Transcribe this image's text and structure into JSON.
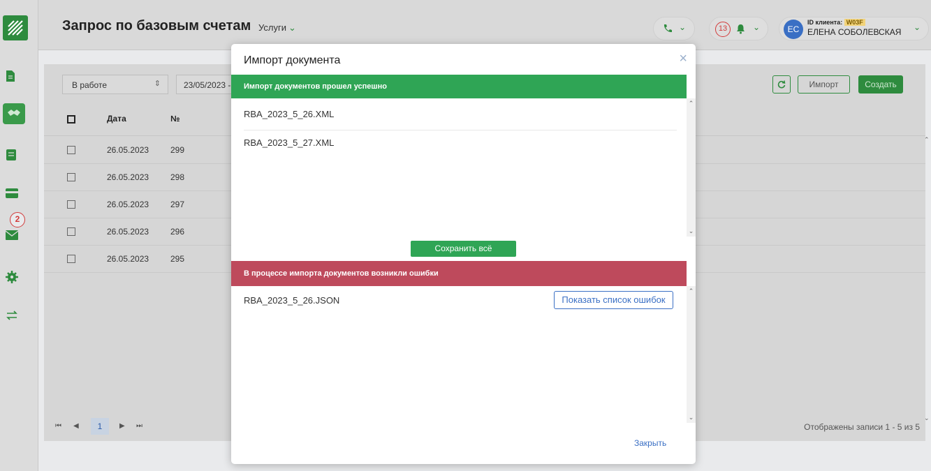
{
  "header": {
    "title": "Запрос по базовым счетам",
    "services_label": "Услуги",
    "notifications_count": "13",
    "client_id_label": "ID клиента:",
    "client_id_value": "W03F",
    "user_initials": "ЕС",
    "user_name": "ЕЛЕНА СОБОЛЕВСКАЯ"
  },
  "sidebar": {
    "messages_badge": "2",
    "items": [
      "documents-icon",
      "handshake-icon",
      "book-icon",
      "card-icon",
      "mail-icon",
      "gear-icon",
      "transfer-icon"
    ]
  },
  "toolbar": {
    "status_select": "В работе",
    "date_from": "23/05/2023 -",
    "import_label": "Импорт",
    "create_label": "Создать"
  },
  "table": {
    "columns": [
      "Дата",
      "№"
    ],
    "rows": [
      {
        "date": "26.05.2023",
        "num": "299"
      },
      {
        "date": "26.05.2023",
        "num": "298"
      },
      {
        "date": "26.05.2023",
        "num": "297"
      },
      {
        "date": "26.05.2023",
        "num": "296"
      },
      {
        "date": "26.05.2023",
        "num": "295"
      }
    ]
  },
  "pager": {
    "current_page": "1",
    "records_info": "Отображены записи 1 - 5 из 5"
  },
  "modal": {
    "title": "Импорт документа",
    "close_symbol": "×",
    "success_message": "Импорт документов прошел успешно",
    "success_files": [
      "RBA_2023_5_26.XML",
      "RBA_2023_5_27.XML"
    ],
    "save_all_label": "Сохранить всё",
    "error_message": "В процессе импорта документов возникли ошибки",
    "error_files": [
      "RBA_2023_5_26.JSON"
    ],
    "show_errors_label": "Показать список ошибок",
    "close_label": "Закрыть"
  },
  "colors": {
    "brand_green": "#2e8b3e",
    "success_bar": "#2fa555",
    "error_bar": "#be4a5c",
    "link_blue": "#3a6fc4",
    "badge_red": "#d23a3a"
  }
}
